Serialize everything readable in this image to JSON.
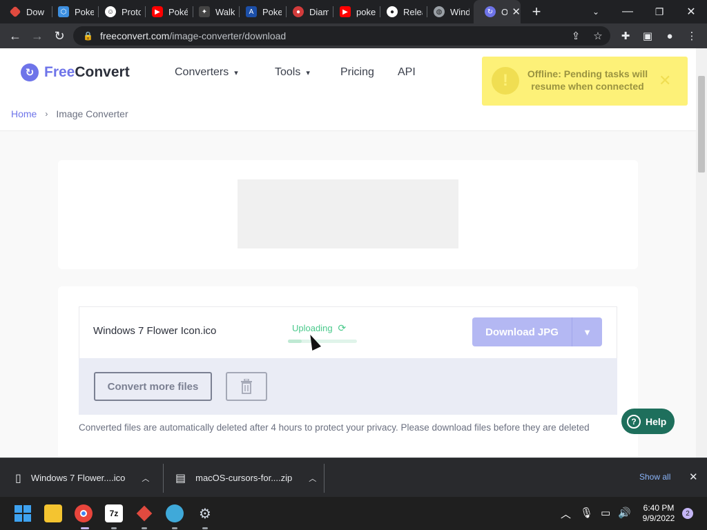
{
  "browser": {
    "tabs": [
      {
        "title": "Dow",
        "icon": "diamond-favicon",
        "color": "#e04a3f"
      },
      {
        "title": "Poke",
        "icon": "hex-favicon",
        "color": "#3d8fe0"
      },
      {
        "title": "Proto",
        "icon": "proto-favicon",
        "color": "#ffffff"
      },
      {
        "title": "Poké",
        "icon": "youtube-favicon",
        "color": "#ff0000"
      },
      {
        "title": "Walk",
        "icon": "walk-favicon",
        "color": "#444444"
      },
      {
        "title": "Poke",
        "icon": "a-favicon",
        "color": "#1c4fa8"
      },
      {
        "title": "Diam",
        "icon": "pokeball-favicon",
        "color": "#d23b3b"
      },
      {
        "title": "poke",
        "icon": "youtube-favicon",
        "color": "#ff0000"
      },
      {
        "title": "Relea",
        "icon": "github-favicon",
        "color": "#ffffff"
      },
      {
        "title": "Wind",
        "icon": "globe-favicon",
        "color": "#9aa0a6"
      },
      {
        "title": "O",
        "icon": "freeconvert-favicon",
        "color": "#6e74e9",
        "active": true
      }
    ],
    "url_host": "freeconvert.com",
    "url_path": "/image-converter/download"
  },
  "site": {
    "logo_free": "Free",
    "logo_convert": "Convert",
    "nav": {
      "converters": "Converters",
      "tools": "Tools",
      "pricing": "Pricing",
      "api": "API"
    },
    "breadcrumb": {
      "home": "Home",
      "current": "Image Converter"
    }
  },
  "toast": {
    "message": "Offline: Pending tasks will resume when connected",
    "color": "#fdf178"
  },
  "file": {
    "name": "Windows 7 Flower Icon.ico",
    "status": "Uploading",
    "progress": 0.2,
    "download_label": "Download JPG"
  },
  "actions": {
    "convert_more": "Convert more files"
  },
  "privacy_note": "Converted files are automatically deleted after 4 hours to protect your privacy. Please download files before they are deleted",
  "help_label": "Help",
  "downloads_bar": {
    "items": [
      "Windows 7 Flower....ico",
      "macOS-cursors-for....zip"
    ],
    "show_all": "Show all"
  },
  "taskbar": {
    "time": "6:40 PM",
    "date": "9/9/2022",
    "notifications": "2",
    "apps": [
      "windows-start-icon",
      "file-explorer-icon",
      "chrome-icon",
      "7zip-icon",
      "red-diamond-app-icon",
      "world-app-icon",
      "settings-gear-icon"
    ]
  }
}
